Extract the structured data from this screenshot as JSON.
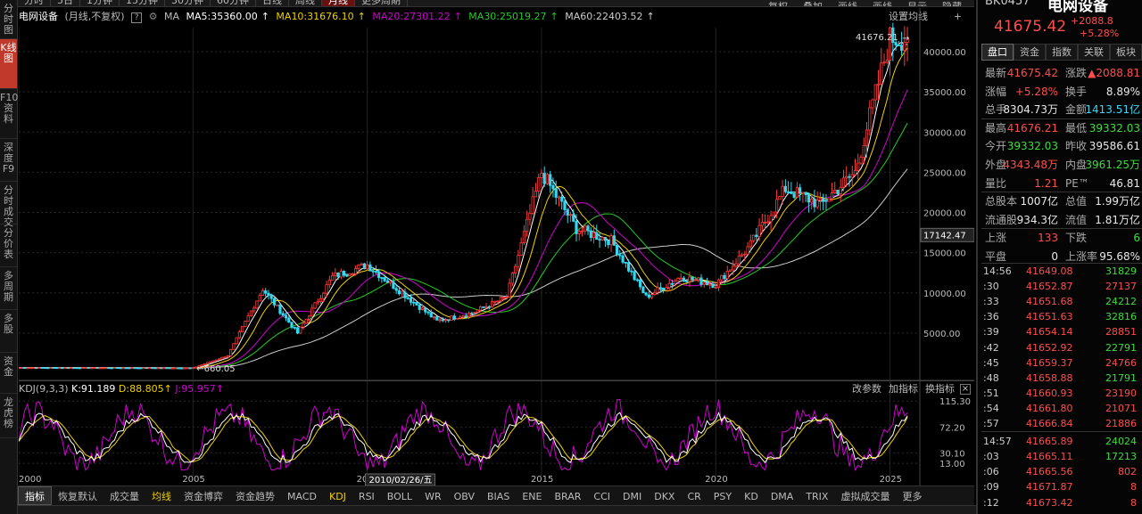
{
  "period_toolbar": {
    "items": [
      "分时",
      "5日",
      "1分钟",
      "15分钟",
      "30分钟",
      "60分钟",
      "日线",
      "周线",
      "月线",
      "更多周期"
    ],
    "active": "月线",
    "right_items": [
      "复权",
      "叠加",
      "画线",
      "画线",
      "显示",
      "隐藏"
    ]
  },
  "sidebar": {
    "tabs": [
      "分时图",
      "K线图",
      "F10资料",
      "深度F9",
      "分时成交",
      "分价表",
      "多周期",
      "多股",
      "资金",
      "龙虎榜"
    ],
    "active": "K线图"
  },
  "chart_header": {
    "name": "电网设备",
    "mode": "(月线,不复权)",
    "ma_label": "MA",
    "ma5": "MA5:35360.00",
    "ma10": "MA10:31676.10",
    "ma20": "MA20:27301.22",
    "ma30": "MA30:25019.27",
    "ma60": "MA60:22403.52",
    "settings": "设置均线"
  },
  "kdj_header": {
    "label": "KDJ(9,3,3)",
    "k": "K:91.189",
    "d": "D:88.805",
    "j": "J:95.957",
    "actions": [
      "改参数",
      "加指标",
      "换指标"
    ]
  },
  "annotations": {
    "high_label": "41676.21",
    "low_label": "660.05",
    "cursor_price": "17142.47",
    "cursor_date": "2010/02/26/五"
  },
  "chart_data": [
    {
      "type": "candlestick",
      "title": "电网设备 (月线,不复权)",
      "y_ticks": [
        "40000.00",
        "35000.00",
        "30000.00",
        "25000.00",
        "20000.00",
        "15000.00",
        "10000.00",
        "5000.00"
      ],
      "ylim": [
        0,
        43000
      ],
      "x_ticks": [
        "2000",
        "2005",
        "2010",
        "2015",
        "2020",
        "2025"
      ],
      "series": [
        {
          "name": "MA5",
          "color": "#ffffff"
        },
        {
          "name": "MA10",
          "color": "#f0d000"
        },
        {
          "name": "MA20",
          "color": "#d100d1"
        },
        {
          "name": "MA30",
          "color": "#22cc22"
        },
        {
          "name": "MA60",
          "color": "#cccccc"
        }
      ],
      "closes": [
        {
          "date": "2000",
          "close": 700
        },
        {
          "date": "2003",
          "close": 680
        },
        {
          "date": "2005",
          "close": 660
        },
        {
          "date": "2006",
          "close": 2200
        },
        {
          "date": "2007",
          "close": 10500
        },
        {
          "date": "2008",
          "close": 5000
        },
        {
          "date": "2009",
          "close": 12000
        },
        {
          "date": "2010",
          "close": 13500
        },
        {
          "date": "2011",
          "close": 10000
        },
        {
          "date": "2012",
          "close": 6500
        },
        {
          "date": "2013",
          "close": 7500
        },
        {
          "date": "2014",
          "close": 9500
        },
        {
          "date": "2015",
          "close": 25000
        },
        {
          "date": "2016",
          "close": 18000
        },
        {
          "date": "2017",
          "close": 16500
        },
        {
          "date": "2018",
          "close": 9500
        },
        {
          "date": "2019",
          "close": 12000
        },
        {
          "date": "2020",
          "close": 11000
        },
        {
          "date": "2021",
          "close": 16000
        },
        {
          "date": "2022",
          "close": 23000
        },
        {
          "date": "2023",
          "close": 21000
        },
        {
          "date": "2024",
          "close": 25000
        },
        {
          "date": "2025",
          "close": 41675.42
        }
      ]
    },
    {
      "type": "line",
      "title": "KDJ(9,3,3)",
      "y_ticks": [
        "115.30",
        "72.20",
        "30.10",
        "13.00"
      ],
      "series": [
        {
          "name": "K",
          "value": 91.189,
          "color": "#ffffff"
        },
        {
          "name": "D",
          "value": 88.805,
          "color": "#f0d000"
        },
        {
          "name": "J",
          "value": 95.957,
          "color": "#d100d1"
        }
      ]
    }
  ],
  "bottom_tabs": {
    "items": [
      "指标",
      "恢复默认",
      "成交量",
      "均线",
      "资金博弈",
      "资金趋势",
      "MACD",
      "KDJ",
      "RSI",
      "BOLL",
      "WR",
      "OBV",
      "BIAS",
      "ENE",
      "BRAR",
      "CCI",
      "DMI",
      "DKX",
      "CR",
      "PSY",
      "KD",
      "DMA",
      "TRIX",
      "虚拟成交量",
      "更多"
    ],
    "active": "指标",
    "highlighted": [
      "均线",
      "KDJ"
    ]
  },
  "quote_panel": {
    "code": "BK0457",
    "name": "电网设备",
    "price": "41675.42",
    "change": "+2088.8",
    "change_pct": "+5.28%",
    "tabs": [
      "盘口",
      "资金",
      "指数",
      "关联",
      "板块"
    ],
    "active_tab": "盘口",
    "rows": [
      {
        "l1": "最新",
        "v1": "41675.42",
        "c1": "red",
        "l2": "涨跌",
        "v2": "▲2088.81",
        "c2": "red"
      },
      {
        "l1": "涨幅",
        "v1": "+5.28%",
        "c1": "red",
        "l2": "换手",
        "v2": "8.89%",
        "c2": "wht"
      },
      {
        "l1": "总手",
        "v1": "8304.73万",
        "c1": "wht",
        "l2": "金额",
        "v2": "1413.51亿",
        "c2": "cyn"
      },
      {
        "l1": "最高",
        "v1": "41676.21",
        "c1": "red",
        "l2": "最低",
        "v2": "39332.03",
        "c2": "grn"
      },
      {
        "l1": "今开",
        "v1": "39332.03",
        "c1": "grn",
        "l2": "昨收",
        "v2": "39586.61",
        "c2": "wht"
      },
      {
        "l1": "外盘",
        "v1": "4343.48万",
        "c1": "red",
        "l2": "内盘",
        "v2": "3961.25万",
        "c2": "grn"
      },
      {
        "l1": "量比",
        "v1": "1.21",
        "c1": "red",
        "l2": "PE™",
        "v2": "46.81",
        "c2": "wht"
      },
      {
        "l1": "总股本",
        "v1": "1007亿",
        "c1": "wht",
        "l2": "总值",
        "v2": "1.99万亿",
        "c2": "wht"
      },
      {
        "l1": "流通股",
        "v1": "934.3亿",
        "c1": "wht",
        "l2": "流值",
        "v2": "1.81万亿",
        "c2": "wht"
      },
      {
        "l1": "上涨",
        "v1": "133",
        "c1": "red",
        "l2": "下跌",
        "v2": "6",
        "c2": "grn"
      },
      {
        "l1": "平盘",
        "v1": "0",
        "c1": "wht",
        "l2": "上涨率",
        "v2": "95.68%",
        "c2": "wht"
      }
    ],
    "ticks": [
      {
        "t": "14:56",
        "p": "41649.08",
        "v": "31829",
        "c": "grn"
      },
      {
        "t": ":30",
        "p": "41652.87",
        "v": "27137",
        "c": "red"
      },
      {
        "t": ":33",
        "p": "41651.68",
        "v": "24212",
        "c": "grn"
      },
      {
        "t": ":36",
        "p": "41651.63",
        "v": "32816",
        "c": "grn"
      },
      {
        "t": ":39",
        "p": "41654.14",
        "v": "28851",
        "c": "red"
      },
      {
        "t": ":42",
        "p": "41652.92",
        "v": "22791",
        "c": "grn"
      },
      {
        "t": ":45",
        "p": "41659.37",
        "v": "24766",
        "c": "red"
      },
      {
        "t": ":48",
        "p": "41658.88",
        "v": "21791",
        "c": "grn"
      },
      {
        "t": ":51",
        "p": "41660.93",
        "v": "23190",
        "c": "red"
      },
      {
        "t": ":54",
        "p": "41661.80",
        "v": "21071",
        "c": "red"
      },
      {
        "t": ":57",
        "p": "41666.84",
        "v": "21886",
        "c": "red"
      },
      {
        "t": "14:57",
        "p": "41665.89",
        "v": "24024",
        "c": "grn"
      },
      {
        "t": ":03",
        "p": "41665.11",
        "v": "17213",
        "c": "grn"
      },
      {
        "t": ":06",
        "p": "41665.56",
        "v": "802",
        "c": "red"
      },
      {
        "t": ":09",
        "p": "41671.87",
        "v": "8",
        "c": "red"
      },
      {
        "t": ":12",
        "p": "41673.42",
        "v": "8",
        "c": "red"
      },
      {
        "t": ":15",
        "p": "41675.42",
        "v": "18351",
        "c": "red"
      }
    ]
  }
}
